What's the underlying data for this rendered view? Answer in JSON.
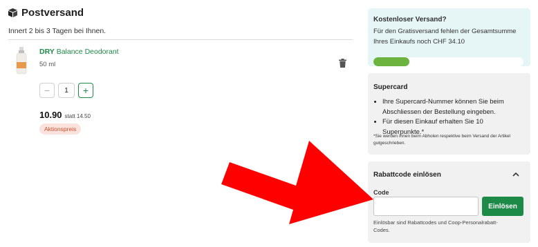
{
  "shipping": {
    "title": "Postversand",
    "subtitle": "Innert 2 bis 3 Tagen bei Ihnen."
  },
  "product": {
    "brand": "DRY",
    "name": "Balance Deodorant",
    "size": "50 ml",
    "quantity": "1",
    "price": "10.90",
    "old_price": "statt 14.50",
    "promo_label": "Aktionspreis"
  },
  "free_shipping": {
    "title": "Kostenloser Versand?",
    "text": "Für den Gratisversand fehlen der Gesamtsumme Ihres Einkaufs noch CHF 34.10",
    "progress_fraction": 0.24,
    "bar_color": "#6cb33f"
  },
  "supercard": {
    "title": "Supercard",
    "bullets": [
      "Ihre Supercard-Nummer können Sie beim Abschliessen der Bestellung eingeben.",
      "Für diesen Einkauf erhalten Sie 10 Superpunkte.*"
    ],
    "note": "*Sie werden Ihnen beim Abholen respektive beim Versand der Artikel gutgeschrieben."
  },
  "discount": {
    "title": "Rabattcode einlösen",
    "code_label": "Code",
    "code_value": "",
    "button_label": "Einlösen",
    "help": "Einlösbar sind Rabattcodes und Coop-Personalrabatt-Codes."
  },
  "colors": {
    "accent": "#1e8a48",
    "arrow": "#ff0000"
  }
}
